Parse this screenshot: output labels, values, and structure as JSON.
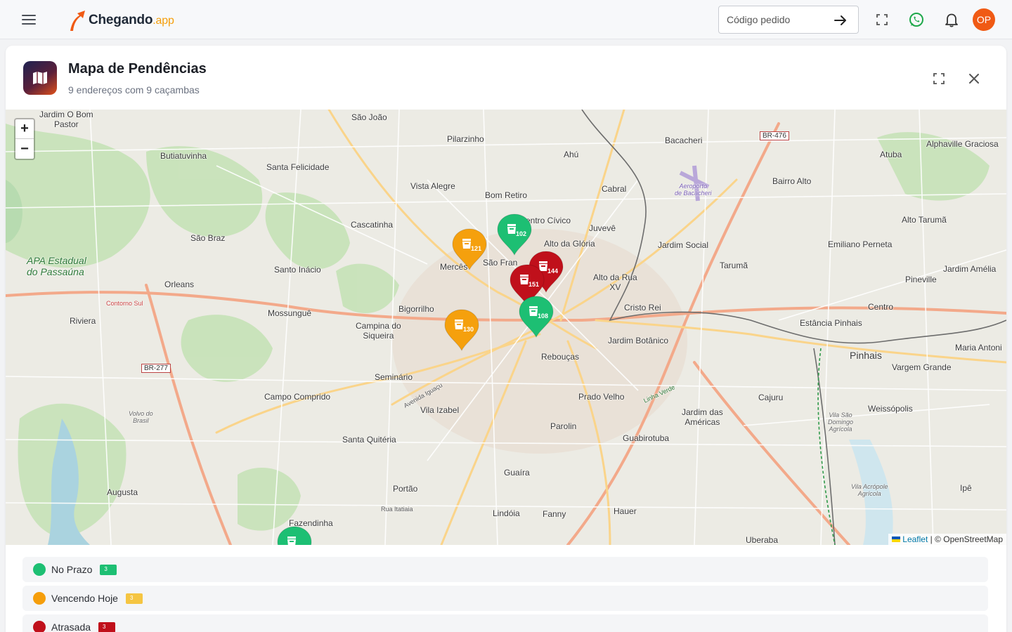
{
  "app": {
    "logo_name": "Chegando",
    "logo_suffix": ".app",
    "order_placeholder": "Código pedido",
    "avatar_initials": "OP",
    "brand_color": "#f05a14"
  },
  "page": {
    "title": "Mapa de Pendências",
    "subtitle": "9 endereços com 9 caçambas"
  },
  "map": {
    "zoom_in": "+",
    "zoom_out": "−",
    "attribution_link": "Leaflet",
    "attribution_text": "| © OpenStreetMap",
    "labels": {
      "jardim_o_bom_pastor": "Jardim O Bom\nPastor",
      "sao_joao": "São João",
      "pilarzinho": "Pilarzinho",
      "ahu": "Ahú",
      "bacacheri": "Bacacheri",
      "atuba": "Atuba",
      "alphaville": "Alphaville Graciosa",
      "butiatuvinha": "Butiatuvinha",
      "santa_felicidade": "Santa Felicidade",
      "vista_alegre": "Vista Alegre",
      "bom_retiro": "Bom Retiro",
      "cabral": "Cabral",
      "aeroporto": "Aeroporto\nde Bacacheri",
      "bairro_alto": "Bairro Alto",
      "alto_taruma": "Alto Tarumã",
      "cascatinha": "Cascatinha",
      "centro_civico": "entro Cívico",
      "juveve": "Juvevê",
      "sao_braz": "São Braz",
      "alto_da_gloria": "Alto da Glória",
      "jardim_social": "Jardim Social",
      "emiliano_perneta": "Emiliano Perneta",
      "apa": "APA Estadual\ndo Passaúna",
      "santo_inacio": "Santo Inácio",
      "merces": "Mercês",
      "sao_francisco": "São Fran",
      "taruma": "Tarumã",
      "jardim_amelia": "Jardim Amélia",
      "orleans": "Orleans",
      "alto_da_rua_xv": "Alto da Rua\nXV",
      "pineville": "Pineville",
      "contorno_sul": "Contorno Sul",
      "mossungue": "Mossunguê",
      "bigorrilho": "Bigorrilho",
      "cristo_rei": "Cristo Rei",
      "centro": "Centro",
      "riviera": "Riviera",
      "campina_do_siqueira": "Campina do\nSiqueira",
      "estancia_pinhais": "Estância Pinhais",
      "jardim_botanico": "Jardim Botânico",
      "maria_antonieta": "Maria Antoni",
      "br277": "BR-277",
      "reboucas": "Rebouças",
      "pinhais": "Pinhais",
      "vargem_grande": "Vargem Grande",
      "seminario": "Seminário",
      "campo_comprido": "Campo Comprido",
      "vila_izabel": "Vila Izabel",
      "prado_velho": "Prado Velho",
      "linha_verde": "Linha Verde",
      "cajuru": "Cajuru",
      "jardim_das_americas": "Jardim das\nAméricas",
      "weissopolis": "Weissópolis",
      "volvo": "Volvo do\nBrasil",
      "parolin": "Parolin",
      "vila_sao_domingo": "Vila São\nDomingo\nAgrícola",
      "santa_quiteria": "Santa Quitéria",
      "guabirotuba": "Guabirotuba",
      "guaira": "Guaíra",
      "augusta": "Augusta",
      "portao": "Portão",
      "vila_acropole": "Vila Acrópole\nAgrícola",
      "ipe": "Ipê",
      "rua_itatiaia": "Rua Itatiaia",
      "lindoia": "Lindóia",
      "fanny": "Fanny",
      "hauer": "Hauer",
      "fazendinha": "Fazendinha",
      "uberaba": "Uberaba",
      "br476": "BR-476",
      "avenida_iguacu": "Avenida Iguaçu"
    },
    "pins": [
      {
        "id": "121",
        "status": "vencendo"
      },
      {
        "id": "102",
        "status": "prazo"
      },
      {
        "id": "144",
        "status": "atrasada"
      },
      {
        "id": "151",
        "status": "atrasada"
      },
      {
        "id": "108",
        "status": "prazo"
      },
      {
        "id": "130",
        "status": "vencendo"
      },
      {
        "id": "",
        "status": "prazo"
      }
    ]
  },
  "legend": [
    {
      "label": "No Prazo",
      "count": "3",
      "color": "#1dbf73"
    },
    {
      "label": "Vencendo Hoje",
      "count": "3",
      "color": "#f59e0b"
    },
    {
      "label": "Atrasada",
      "count": "3",
      "color": "#c0101b"
    }
  ],
  "colors": {
    "prazo": "#1dbf73",
    "vencendo": "#f5a00d",
    "atrasada": "#c0101b"
  }
}
